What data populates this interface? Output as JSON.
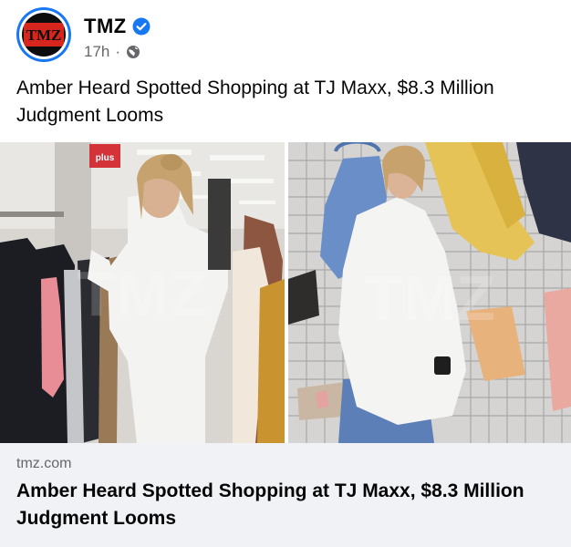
{
  "post": {
    "page_name": "TMZ",
    "logo_text": "TMZ",
    "time": "17h",
    "separator": "·",
    "text": "Amber Heard Spotted Shopping at TJ Maxx, $8.3 Million Judgment Looms",
    "icons": {
      "avatar": "tmz-logo-avatar",
      "verified": "verified-badge-icon",
      "audience": "globe-icon"
    },
    "colors": {
      "brand_blue": "#1877f2",
      "logo_red": "#d7261e"
    }
  },
  "media": {
    "left_photo": {
      "sign_text": "plus",
      "watermark": "TMZ"
    },
    "right_photo": {
      "watermark": "TMZ"
    }
  },
  "link_card": {
    "domain": "tmz.com",
    "title": "Amber Heard Spotted Shopping at TJ Maxx, $8.3 Million Judgment Looms"
  }
}
